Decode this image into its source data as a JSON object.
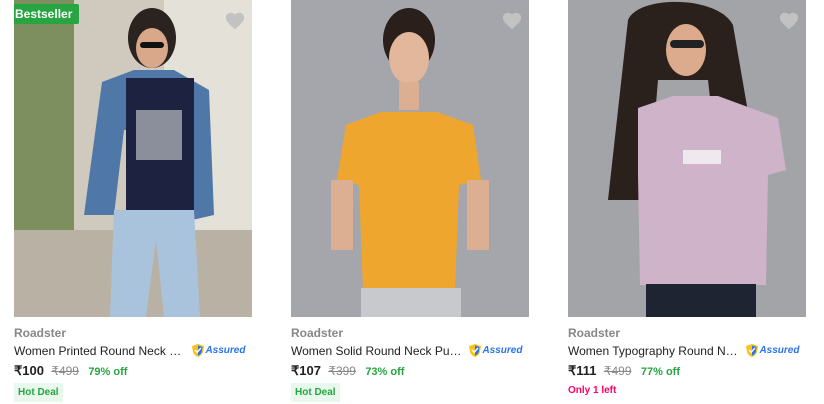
{
  "products": [
    {
      "badge": "Bestseller",
      "brand": "Roadster",
      "title": "Women Printed Round Neck Pure Cotton T-shirt",
      "assured_label": "Assured",
      "price": "₹100",
      "mrp": "₹499",
      "discount": "79% off",
      "tag": "Hot Deal",
      "tag_type": "deal"
    },
    {
      "badge": "",
      "brand": "Roadster",
      "title": "Women Solid Round Neck Pure Cotton T-shirt",
      "assured_label": "Assured",
      "price": "₹107",
      "mrp": "₹399",
      "discount": "73% off",
      "tag": "Hot Deal",
      "tag_type": "deal"
    },
    {
      "badge": "",
      "brand": "Roadster",
      "title": "Women Typography Round Neck T-shirt",
      "assured_label": "Assured",
      "price": "₹111",
      "mrp": "₹499",
      "discount": "77% off",
      "tag": "Only 1 left",
      "tag_type": "stock"
    }
  ],
  "icons": {
    "wishlist": "heart-icon",
    "assured": "shield-check-icon"
  },
  "colors": {
    "badge_green": "#26a541",
    "discount_green": "#26a541",
    "stock_pink": "#ff0066",
    "assured_blue": "#2874f0"
  }
}
